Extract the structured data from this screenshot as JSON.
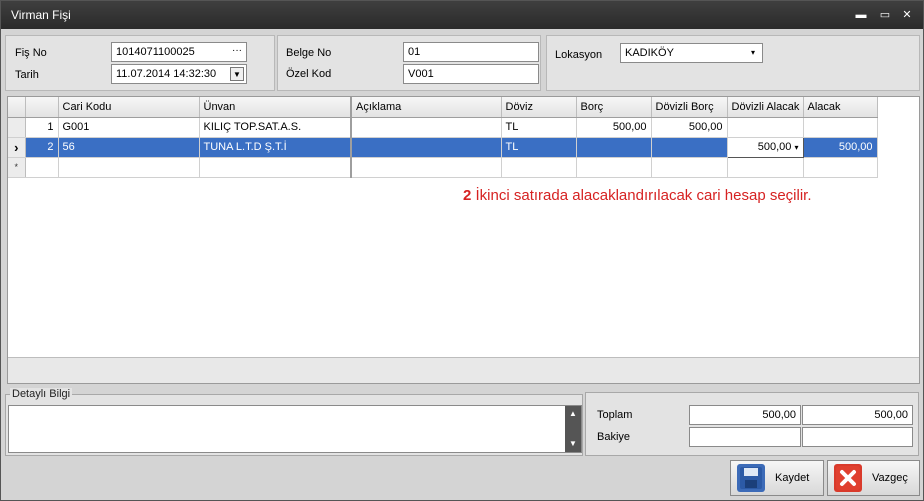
{
  "window": {
    "title": "Virman Fişi",
    "controls": {
      "minimize": "▬",
      "maximize": "▭",
      "close": "✕"
    }
  },
  "header": {
    "fis_no_label": "Fiş No",
    "fis_no_value": "1014071100025",
    "fis_no_button": "···",
    "tarih_label": "Tarih",
    "tarih_value": "11.07.2014 14:32:30",
    "belge_no_label": "Belge No",
    "belge_no_value": "01",
    "ozel_kod_label": "Özel Kod",
    "ozel_kod_value": "V001",
    "lokasyon_label": "Lokasyon",
    "lokasyon_value": "KADIKÖY"
  },
  "grid": {
    "columns": [
      "",
      "Cari Kodu",
      "Ünvan",
      "Açıklama",
      "Döviz",
      "Borç",
      "Dövizli Borç",
      "Dövizli Alacak",
      "Alacak"
    ],
    "rows": [
      {
        "indicator": "",
        "no": "1",
        "cari_kodu": "G001",
        "unvan": "KILIÇ TOP.SAT.A.S.",
        "aciklama": "",
        "doviz": "TL",
        "borc": "500,00",
        "dovizli_borc": "500,00",
        "dovizli_alacak": "",
        "alacak": ""
      },
      {
        "indicator": "›",
        "no": "2",
        "cari_kodu": "56",
        "unvan": "TUNA L.T.D Ş.T.İ",
        "aciklama": "",
        "doviz": "TL",
        "borc": "",
        "dovizli_borc": "",
        "dovizli_alacak": "500,00",
        "alacak": "500,00"
      }
    ],
    "new_row_indicator": "*"
  },
  "annotation": {
    "step": "2",
    "text": " İkinci satırada alacaklandırılacak cari hesap seçilir."
  },
  "detail": {
    "title": "Detaylı Bilgi"
  },
  "totals": {
    "toplam_label": "Toplam",
    "toplam_borc": "500,00",
    "toplam_alacak": "500,00",
    "bakiye_label": "Bakiye"
  },
  "buttons": {
    "save": "Kaydet",
    "cancel": "Vazgeç"
  },
  "colors": {
    "selection": "#3a6fc4",
    "annotation": "#d62222"
  }
}
